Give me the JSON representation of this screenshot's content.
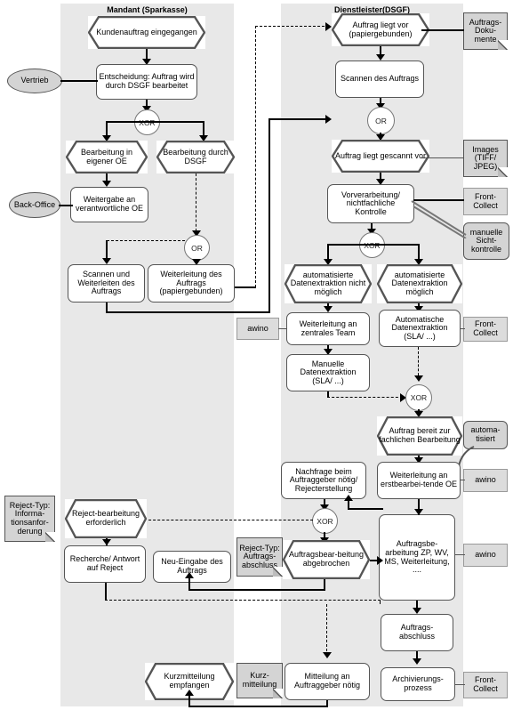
{
  "diagram": {
    "type": "EPC process chain (Ereignisgesteuerte Prozesskette)",
    "lanes": [
      {
        "id": "lane-mandant",
        "title": "Mandant (Sparkasse)"
      },
      {
        "id": "lane-dienstleister",
        "title": "Dienstleister(DSGF)"
      }
    ]
  },
  "nodes": {
    "kundenauftrag": "Kundenauftrag eingegangen",
    "entscheidung": "Entscheidung: Auftrag wird durch DSGF bearbeitet",
    "vertrieb": "Vertrieb",
    "xor1": "XOR",
    "bearbeitung_eigene": "Bearbeitung in eigener OE",
    "bearbeitung_dsgf": "Bearbeitung durch DSGF",
    "backoffice": "Back-Office",
    "weitergabe": "Weitergabe an verantwortliche OE",
    "or_left": "OR",
    "scannen_weiterleiten": "Scannen und Weiterleiten des Auftrags",
    "weiterleitung_auftrag": "Weiterleitung des Auftrags (papiergebunden)",
    "auftrag_liegt_vor": "Auftrag liegt vor (papiergebunden)",
    "auftrags_dokumente": "Auftrags-Doku-mente",
    "scannen_auftrags": "Scannen des Auftrags",
    "or_right": "OR",
    "auftrag_gescannt": "Auftrag liegt gescannt vor",
    "images": "Images (TIFF/ JPEG)",
    "vorverarbeitung": "Vorverarbeitung/ nichtfachliche Kontrolle",
    "frontcollect1": "Front-Collect",
    "manuelle_sicht": "manuelle Sicht-kontrolle",
    "xor2": "XOR",
    "auto_nicht_moeglich": "automatisierte Datenextraktion nicht möglich",
    "auto_moeglich": "automatisierte Datenextraktion möglich",
    "awino1": "awino",
    "weiterleitung_zentral": "Weiterleitung an zentrales Team",
    "auto_datenextraktion": "Automatische Datenextraktion (SLA/ ...)",
    "frontcollect2": "Front-Collect",
    "manuelle_datenextraktion": "Manuelle Datenextraktion (SLA/ ...)",
    "xor3": "XOR",
    "auftrag_bereit": "Auftrag bereit zur fachlichen Bearbeitung",
    "automatisiert": "automa-tisiert",
    "nachfrage": "Nachfrage beim Auftraggeber nötig/ Rejecterstellung",
    "weiterleitung_erstbearb": "Weiterleitung an erstbearbei-tende OE",
    "awino2": "awino",
    "xor4": "XOR",
    "reject_typ_info": "Reject-Typ: Informa-tionsanfor-derung",
    "rejectbearbeitung": "Reject-bearbeitung erforderlich",
    "recherche": "Recherche/ Antwort auf Reject",
    "neu_eingabe": "Neu-Eingabe des Auftrags",
    "reject_typ_abschluss": "Reject-Typ: Auftrags-abschluss",
    "auftragsbearbeitung_abgebrochen": "Auftragsbear-beitung abgebrochen",
    "auftragsbearbeitung": "Auftragsbe-arbeitung ZP, WV, MS, Weiterleitung, ....",
    "awino3": "awino",
    "auftragsabschluss": "Auftrags-abschluss",
    "kurzmitteilung_empfangen": "Kurzmitteilung empfangen",
    "kurzmitteilung_doc": "Kurz-mitteilung",
    "mitteilung_noetig": "Mitteilung an Auftraggeber nötig",
    "archivierungsprozess": "Archivierungs-prozess",
    "frontcollect3": "Front-Collect"
  },
  "colors": {
    "lane_bg": "#e8e8e8",
    "node_border": "#555555",
    "data_object": "#d4d4d4",
    "system_object": "#dcdcdc",
    "canvas": "#ffffff"
  }
}
